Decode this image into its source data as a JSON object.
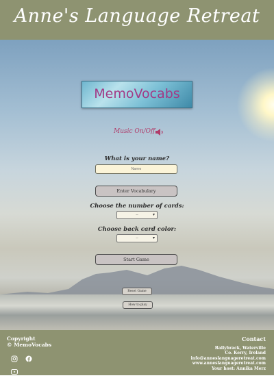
{
  "header": {
    "title": "Anne's Language Retreat"
  },
  "logo": {
    "text": "MemoVocabs"
  },
  "music": {
    "label": "Music On/Off",
    "icon": "speaker-icon"
  },
  "name_section": {
    "question": "What is your name?",
    "placeholder": "Name"
  },
  "buttons": {
    "enter_vocabulary": "Enter Vocabulary",
    "start_game": "Start Game",
    "reset_game": "Reset Game",
    "how_to_play": "How to play"
  },
  "cards_section": {
    "question": "Choose the number of cards:",
    "selected": "--"
  },
  "color_section": {
    "question": "Choose back card color:",
    "selected": "--"
  },
  "footer": {
    "copyright_line1": "Copyright",
    "copyright_line2": "© MemoVocabs",
    "social_icons": [
      "instagram-icon",
      "facebook-icon",
      "youtube-icon"
    ],
    "contact_heading": "Contact",
    "address": [
      "Ballybrack, Waterville",
      "Co. Kerry, Ireland",
      "info@anneslanguageretreat.com",
      "www.anneslanguageretreat.com",
      "Your host: Annika Merz"
    ]
  },
  "colors": {
    "header_bg": "#8e9371",
    "logo_text": "#a23a86",
    "music_label": "#b03c6a",
    "input_bg": "#fbf4d8"
  }
}
